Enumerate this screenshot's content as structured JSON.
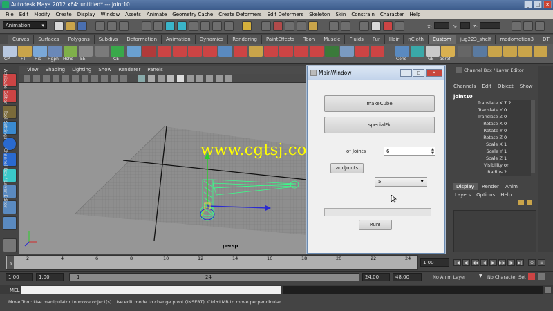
{
  "window": {
    "title": "Autodesk Maya 2012 x64: untitled*    ---    joint10",
    "controls": [
      "_",
      "□",
      "✕"
    ]
  },
  "menubar": [
    "File",
    "Edit",
    "Modify",
    "Create",
    "Display",
    "Window",
    "Assets",
    "Animate",
    "Geometry Cache",
    "Create Deformers",
    "Edit Deformers",
    "Skeleton",
    "Skin",
    "Constrain",
    "Character",
    "Help"
  ],
  "statusline": {
    "mode": "Animation",
    "xyz": [
      "X:",
      "Y:",
      "Z:"
    ]
  },
  "shelf": {
    "tabs": [
      "Curves",
      "Surfaces",
      "Polygons",
      "Subdivs",
      "Deformation",
      "Animation",
      "Dynamics",
      "Rendering",
      "PaintEffects",
      "Toon",
      "Muscle",
      "Fluids",
      "Fur",
      "Hair",
      "nCloth",
      "Custom",
      "jug223_shelf",
      "modomotion3",
      "DT"
    ],
    "active_tab": "Custom",
    "icon_labels": [
      "CP",
      "FT",
      "His",
      "Hgph",
      "Hshd",
      "EE",
      "CE",
      "Cond",
      "GE",
      "aerof"
    ]
  },
  "viewport": {
    "menu": [
      "View",
      "Shading",
      "Lighting",
      "Show",
      "Renderer",
      "Panels"
    ],
    "camera_label": "persp"
  },
  "watermark": "www.cgtsj.com",
  "mainwindow": {
    "title": "MainWindow",
    "make_cube": "makeCube",
    "special_fk": "specialFk",
    "joints_label": "of Joints",
    "joints_value": "6",
    "add_joints": "addJoints",
    "combo_value": "5",
    "run": "Run!"
  },
  "channelbox": {
    "header": "Channel Box / Layer Editor",
    "menu": [
      "Channels",
      "Edit",
      "Object",
      "Show"
    ],
    "object": "joint10",
    "channels": [
      {
        "name": "Translate X",
        "value": "7.2"
      },
      {
        "name": "Translate Y",
        "value": "0"
      },
      {
        "name": "Translate Z",
        "value": "0"
      },
      {
        "name": "Rotate X",
        "value": "0"
      },
      {
        "name": "Rotate Y",
        "value": "0"
      },
      {
        "name": "Rotate Z",
        "value": "0"
      },
      {
        "name": "Scale X",
        "value": "1"
      },
      {
        "name": "Scale Y",
        "value": "1"
      },
      {
        "name": "Scale Z",
        "value": "1"
      },
      {
        "name": "Visibility",
        "value": "on"
      },
      {
        "name": "Radius",
        "value": "2"
      }
    ],
    "layer_tabs": [
      "Display",
      "Render",
      "Anim"
    ],
    "layer_menu": [
      "Layers",
      "Options",
      "Help"
    ]
  },
  "side_tabs": [
    "Attribute Editor",
    "Tool Settings",
    "Channel Box / Layer Editor"
  ],
  "timeline": {
    "ticks": [
      "1",
      "2",
      "4",
      "6",
      "8",
      "10",
      "12",
      "14",
      "16",
      "18",
      "20",
      "22",
      "24"
    ],
    "current_frame": "1.00"
  },
  "range": {
    "start": "1.00",
    "start2": "1.00",
    "slider_start": "1",
    "slider_end": "24",
    "end": "24.00",
    "end2": "48.00",
    "anim_layer": "No Anim Layer",
    "character_set": "No Character Set"
  },
  "mel_label": "MEL",
  "helpline": "Move Tool: Use manipulator to move object(s). Use edit mode to change pivot (INSERT).  Ctrl+LMB to move perpendicular."
}
